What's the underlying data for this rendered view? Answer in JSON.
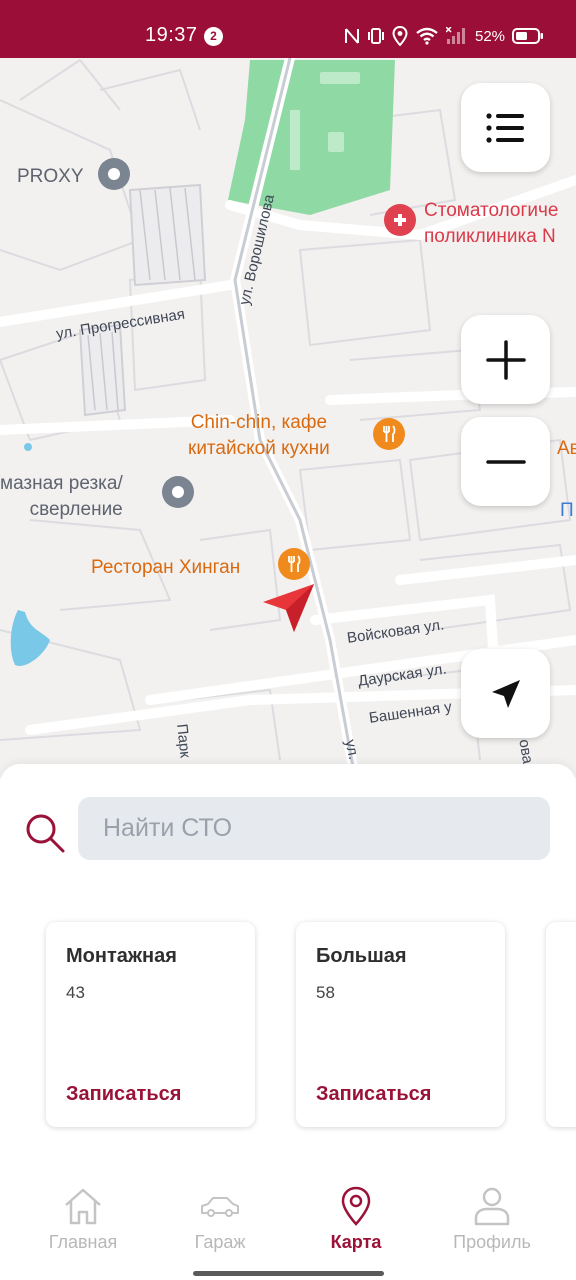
{
  "status_bar": {
    "time": "19:37",
    "notification_count": "2",
    "battery": "52%",
    "background_color": "#9b0e37"
  },
  "map": {
    "labels": {
      "proxy": "PROXY",
      "street_voroshilova": "ул. Ворошилова",
      "dental_line1": "Стоматологиче",
      "dental_line2": "поликлиника N",
      "street_progressivnaya": "ул. Прогрессивная",
      "cafe_line1": "Chin-chin, кафе",
      "cafe_line2": "китайской кухни",
      "av": "Ав",
      "p": "П",
      "cutting_line1": "мазная резка/",
      "cutting_line2": "сверление",
      "restaurant": "Ресторан Хинган",
      "street_voyskovaya": "Войсковая ул.",
      "street_daurskaya": "Даурская ул.",
      "street_bashennaya": "Башенная у",
      "street_park": "Парк",
      "street_ul": "ул.",
      "street_vertical_right": "ова"
    },
    "buttons": {
      "menu": "list-icon",
      "zoom_in": "plus-icon",
      "zoom_out": "minus-icon",
      "locate": "navigation-arrow-icon"
    },
    "colors": {
      "park": "#7fd49a",
      "road": "#ffffff",
      "water": "#7ac8e8",
      "user_marker": "#e8353a"
    }
  },
  "search": {
    "placeholder": "Найти СТО",
    "value": ""
  },
  "cards": [
    {
      "title": "Монтажная",
      "value": "43",
      "action": "Записаться"
    },
    {
      "title": "Большая",
      "value": "58",
      "action": "Записаться"
    }
  ],
  "nav": {
    "items": [
      {
        "label": "Главная",
        "icon": "home-icon",
        "active": false
      },
      {
        "label": "Гараж",
        "icon": "car-icon",
        "active": false
      },
      {
        "label": "Карта",
        "icon": "map-pin-icon",
        "active": true
      },
      {
        "label": "Профиль",
        "icon": "user-icon",
        "active": false
      }
    ],
    "active_color": "#9b1239"
  }
}
